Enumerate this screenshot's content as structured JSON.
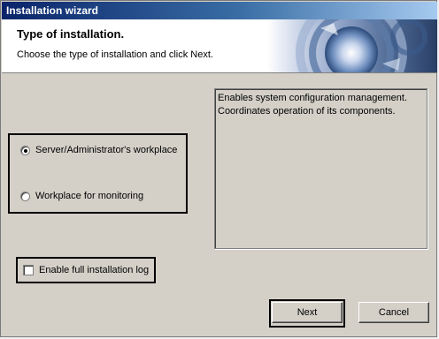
{
  "window": {
    "title": "Installation wizard"
  },
  "header": {
    "title": "Type of installation.",
    "subtitle": "Choose the type of installation and click Next."
  },
  "options": [
    {
      "label": "Server/Administrator's workplace",
      "checked": true
    },
    {
      "label": "Workplace for monitoring",
      "checked": false
    }
  ],
  "description": "Enables system configuration management. Coordinates operation of its components.",
  "log": {
    "label": "Enable full installation log",
    "checked": false
  },
  "buttons": {
    "next": "Next",
    "cancel": "Cancel"
  }
}
